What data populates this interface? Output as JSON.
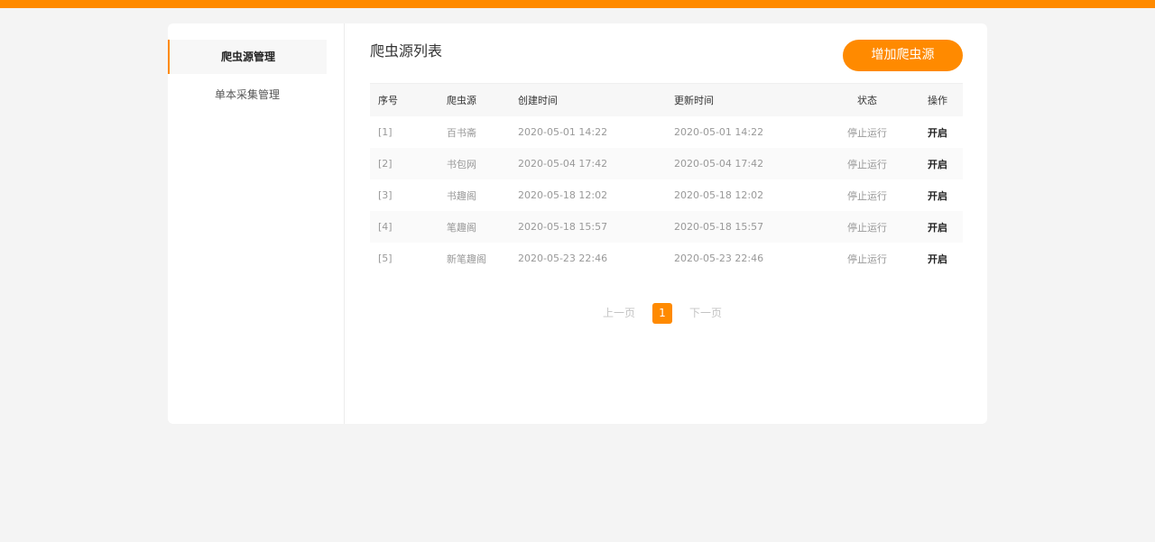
{
  "colors": {
    "accent": "#ff8a00",
    "background": "#f4f4f4"
  },
  "sidebar": {
    "items": [
      {
        "label": "爬虫源管理",
        "active": true
      },
      {
        "label": "单本采集管理",
        "active": false
      }
    ]
  },
  "main": {
    "title": "爬虫源列表",
    "add_button_label": "增加爬虫源"
  },
  "table": {
    "headers": {
      "index": "序号",
      "source": "爬虫源",
      "created": "创建时间",
      "updated": "更新时间",
      "status": "状态",
      "action": "操作"
    },
    "rows": [
      {
        "index": "[1]",
        "source": "百书斋",
        "created": "2020-05-01 14:22",
        "updated": "2020-05-01 14:22",
        "status": "停止运行",
        "action": "开启"
      },
      {
        "index": "[2]",
        "source": "书包网",
        "created": "2020-05-04 17:42",
        "updated": "2020-05-04 17:42",
        "status": "停止运行",
        "action": "开启"
      },
      {
        "index": "[3]",
        "source": "书趣阁",
        "created": "2020-05-18 12:02",
        "updated": "2020-05-18 12:02",
        "status": "停止运行",
        "action": "开启"
      },
      {
        "index": "[4]",
        "source": "笔趣阁",
        "created": "2020-05-18 15:57",
        "updated": "2020-05-18 15:57",
        "status": "停止运行",
        "action": "开启"
      },
      {
        "index": "[5]",
        "source": "新笔趣阁",
        "created": "2020-05-23 22:46",
        "updated": "2020-05-23 22:46",
        "status": "停止运行",
        "action": "开启"
      }
    ]
  },
  "pagination": {
    "prev_label": "上一页",
    "current_page": "1",
    "next_label": "下一页"
  }
}
